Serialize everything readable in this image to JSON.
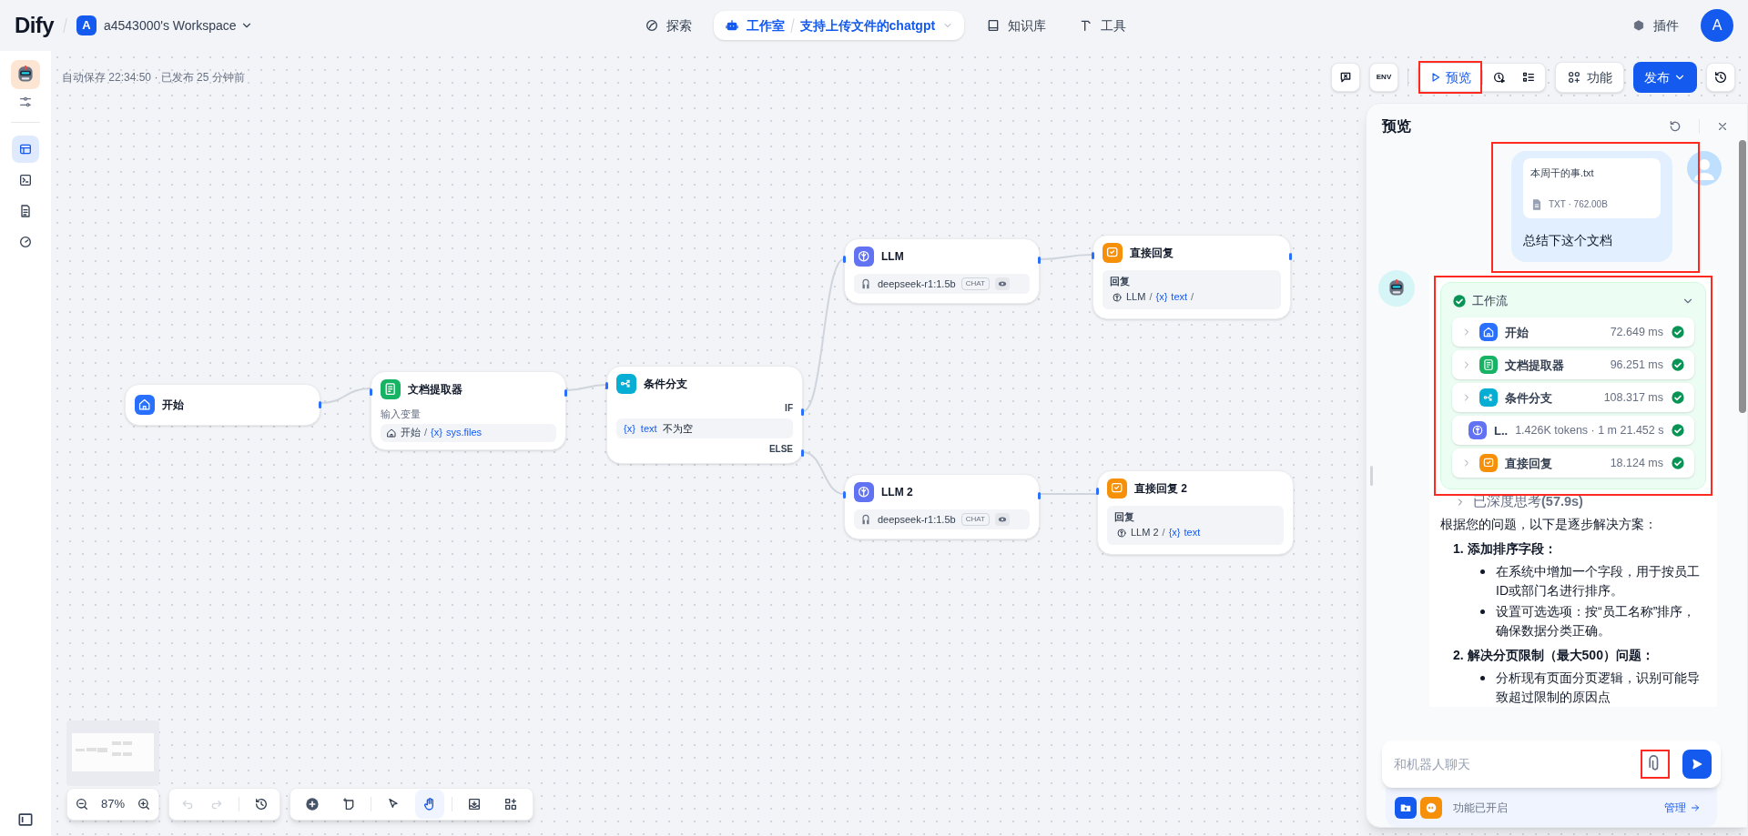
{
  "header": {
    "logo": "Dify",
    "workspace": {
      "initial": "A",
      "name": "a4543000's Workspace"
    },
    "nav": [
      {
        "kind": "explore",
        "label": "探索",
        "selected": false
      },
      {
        "kind": "studio",
        "label": "工作室",
        "selected": true,
        "app_name": "支持上传文件的chatgpt"
      },
      {
        "kind": "knowledge",
        "label": "知识库",
        "selected": false
      },
      {
        "kind": "tools",
        "label": "工具",
        "selected": false
      }
    ],
    "plugins": "插件",
    "avatar": "A"
  },
  "sidebar": {
    "items": [
      {
        "kind": "orchestrate",
        "selected": true
      },
      {
        "kind": "api",
        "selected": false
      },
      {
        "kind": "logs",
        "selected": false
      },
      {
        "kind": "monitoring",
        "selected": false
      }
    ]
  },
  "toolbar": {
    "status": "自动保存 22:34:50 · 已发布 25 分钟前",
    "env": "ENV",
    "preview": "预览",
    "features": "功能",
    "publish": "发布"
  },
  "canvas": {
    "nodes": [
      {
        "kind": "start",
        "title": "开始"
      },
      {
        "kind": "document-extractor",
        "title": "文档提取器",
        "field_label": "输入变量",
        "ref": {
          "kind": "start",
          "node": "开始",
          "separator": "/",
          "var_mark": "{x}",
          "var": "sys.files"
        }
      },
      {
        "kind": "if-else",
        "title": "条件分支",
        "if_label": "IF",
        "else_label": "ELSE",
        "condition": {
          "var_mark": "{x}",
          "var": "text",
          "operator": "不为空"
        }
      },
      {
        "kind": "llm",
        "title": "LLM",
        "model": "deepseek-r1:1.5b",
        "mode": "CHAT"
      },
      {
        "kind": "answer",
        "title": "直接回复",
        "field_label": "回复",
        "ref": {
          "kind": "llm",
          "node": "LLM",
          "separator": "/",
          "var_mark": "{x}",
          "var": "text",
          "trailing": "/"
        }
      },
      {
        "kind": "llm",
        "title": "LLM 2",
        "model": "deepseek-r1:1.5b",
        "mode": "CHAT"
      },
      {
        "kind": "answer",
        "title": "直接回复 2",
        "field_label": "回复",
        "ref": {
          "kind": "llm",
          "node": "LLM 2",
          "separator": "/",
          "var_mark": "{x}",
          "var": "text"
        }
      }
    ]
  },
  "canvas_controls": {
    "zoom": "87%",
    "undo": {
      "disabled": true
    },
    "redo": {
      "disabled": true
    },
    "tools": [
      {
        "kind": "pointer",
        "selected": false
      },
      {
        "kind": "hand",
        "selected": true
      }
    ]
  },
  "preview": {
    "title": "预览",
    "user_message": {
      "file": {
        "name": "本周干的事.txt",
        "meta": "TXT · 762.00B"
      },
      "text": "总结下这个文档"
    },
    "workflow": {
      "title": "工作流",
      "success": true,
      "expanded": true,
      "steps": [
        {
          "kind": "start",
          "name": "开始",
          "time": "72.649 ms",
          "success": true
        },
        {
          "kind": "document-extractor",
          "name": "文档提取器",
          "time": "96.251 ms",
          "success": true
        },
        {
          "kind": "if-else",
          "name": "条件分支",
          "time": "108.317 ms",
          "success": true
        },
        {
          "kind": "llm",
          "name": "L..",
          "time": "1.426K tokens · 1 m 21.452 s",
          "success": true
        },
        {
          "kind": "answer",
          "name": "直接回复",
          "time": "18.124 ms",
          "success": true
        }
      ]
    },
    "thinking": "已深度思考**(57.9s)**",
    "answer": {
      "intro": "根据您的问题，以下是逐步解决方案：",
      "sections": [
        {
          "number": "1.",
          "title": "添加排序字段：",
          "bullets": [
            "在系统中增加一个字段，用于按员工ID或部门名进行排序。",
            "设置可选选项：按“员工名称”排序，确保数据分类正确。"
          ]
        },
        {
          "number": "2.",
          "title": "解决分页限制（最大500）问题：",
          "bullets": [
            "分析现有页面分页逻辑，识别可能导致超过限制的原因点"
          ]
        }
      ]
    },
    "input": {
      "placeholder": "和机器人聊天"
    },
    "features": {
      "label": "功能已开启",
      "manage": "管理"
    }
  }
}
